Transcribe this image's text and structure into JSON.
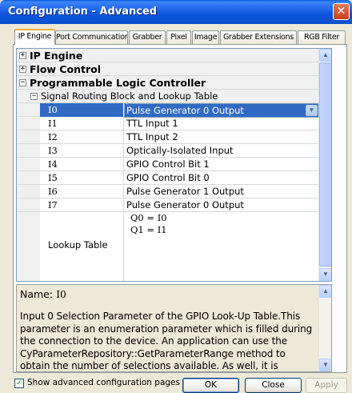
{
  "window": {
    "title": "Configuration - Advanced",
    "close_glyph": "✕"
  },
  "tabs": [
    {
      "label": "IP Engine",
      "active": true
    },
    {
      "label": "Port Communication",
      "active": false
    },
    {
      "label": "Grabber",
      "active": false
    },
    {
      "label": "Pixel",
      "active": false
    },
    {
      "label": "Image",
      "active": false
    },
    {
      "label": "Grabber Extensions",
      "active": false
    },
    {
      "label": "RGB Filter",
      "active": false
    }
  ],
  "grid": {
    "categories": [
      {
        "label": "IP Engine",
        "expander": "+"
      },
      {
        "label": "Flow Control",
        "expander": "+"
      },
      {
        "label": "Programmable Logic Controller",
        "expander": "−"
      }
    ],
    "subcategory": {
      "label": "Signal Routing Block and Lookup Table",
      "expander": "−"
    },
    "properties": [
      {
        "name": "I0",
        "value": "Pulse Generator 0 Output",
        "selected": true
      },
      {
        "name": "I1",
        "value": "TTL Input 1"
      },
      {
        "name": "I2",
        "value": "TTL Input 2"
      },
      {
        "name": "I3",
        "value": "Optically-Isolated Input"
      },
      {
        "name": "I4",
        "value": "GPIO Control Bit 1"
      },
      {
        "name": "I5",
        "value": "GPIO Control Bit 0"
      },
      {
        "name": "I6",
        "value": "Pulse Generator 1 Output"
      },
      {
        "name": "I7",
        "value": "Pulse Generator 0 Output"
      }
    ],
    "lookup_table": {
      "name": "Lookup Table",
      "lines": [
        "Q0 = I0",
        "Q1 = I1"
      ]
    }
  },
  "description": {
    "name_label": "Name:",
    "name_value": "I0",
    "text": "Input 0 Selection Parameter of the GPIO Look-Up Table.This parameter is an enumeration parameter which is filled during the connection to the device.  An application can use the CyParameterRepository::GetParameterRange method to obtain the number of selections available.  As well, it is possible to obtain the"
  },
  "footer": {
    "show_advanced_label": "Show advanced configuration pages",
    "show_advanced_checked": true,
    "check_glyph": "✓",
    "ok_label": "OK",
    "close_label": "Close",
    "apply_label": "Apply"
  },
  "colors": {
    "titlebar": "#0b55dc",
    "selection": "#316ac5",
    "active_tab_accent": "#fbb03a"
  }
}
